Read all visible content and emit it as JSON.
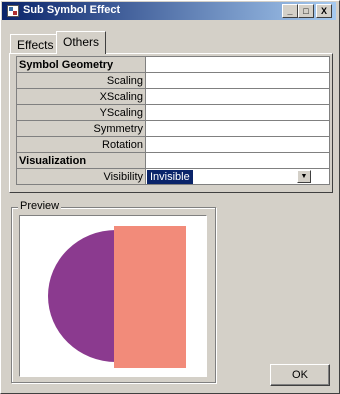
{
  "window": {
    "title": "Sub Symbol Effect"
  },
  "titlebar_buttons": {
    "minimize": "_",
    "maximize": "□",
    "close": "X"
  },
  "tabs": [
    {
      "label": "Effects",
      "selected": false
    },
    {
      "label": "Others",
      "selected": true
    }
  ],
  "properties": {
    "geometry_header": "Symbol Geometry",
    "scaling": {
      "label": "Scaling",
      "value": ""
    },
    "xscaling": {
      "label": "XScaling",
      "value": ""
    },
    "yscaling": {
      "label": "YScaling",
      "value": ""
    },
    "symmetry": {
      "label": "Symmetry",
      "value": ""
    },
    "rotation": {
      "label": "Rotation",
      "value": ""
    },
    "visualization_header": "Visualization",
    "visibility": {
      "label": "Visibility",
      "value": "Invisible"
    }
  },
  "preview": {
    "label": "Preview",
    "colors": {
      "semicircle": "#8b3a8f",
      "rectangle": "#f28b7a"
    }
  },
  "buttons": {
    "ok": "OK"
  }
}
